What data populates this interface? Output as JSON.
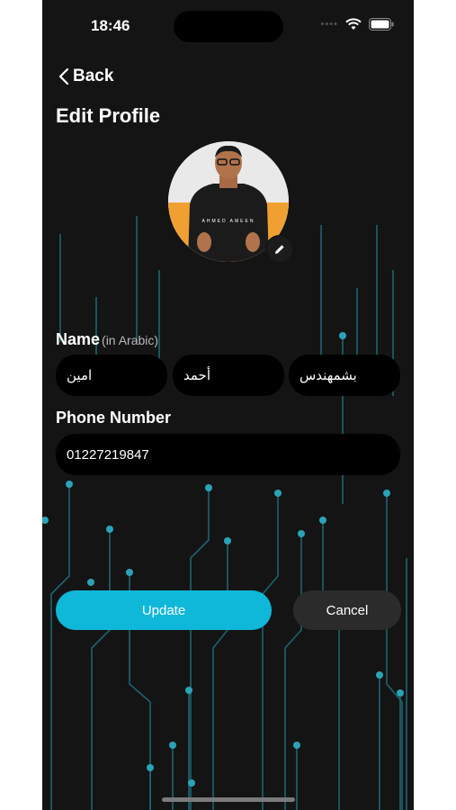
{
  "status_bar": {
    "time": "18:46",
    "icons": [
      "signal-dots-icon",
      "wifi-icon",
      "battery-icon"
    ]
  },
  "header": {
    "back_label": "Back",
    "title": "Edit Profile"
  },
  "avatar": {
    "shirt_text": "AHMED AMEEN",
    "edit_icon": "pencil-icon",
    "accent_color": "#f0a030"
  },
  "name_section": {
    "label": "Name",
    "sublabel": "(in Arabic)",
    "fields": [
      "امين",
      "أحمد",
      "بشمهندس"
    ]
  },
  "phone_section": {
    "label": "Phone Number",
    "value": "01227219847"
  },
  "actions": {
    "update_label": "Update",
    "cancel_label": "Cancel"
  },
  "colors": {
    "background": "#141414",
    "accent": "#0fb8d8",
    "field": "#000000",
    "circuit": "#1f7f90"
  }
}
